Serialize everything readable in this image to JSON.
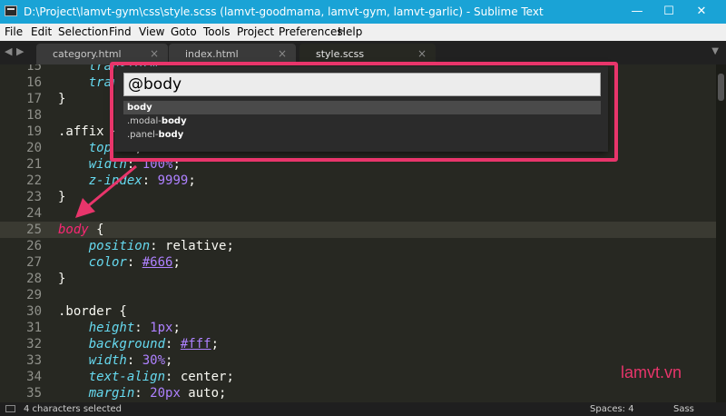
{
  "window": {
    "title": "D:\\Project\\lamvt-gym\\css\\style.scss (lamvt-goodmama, lamvt-gym, lamvt-garlic) - Sublime Text",
    "minimize": "—",
    "maximize": "☐",
    "close": "✕"
  },
  "menu": [
    "File",
    "Edit",
    "Selection",
    "Find",
    "View",
    "Goto",
    "Tools",
    "Project",
    "Preferences",
    "Help"
  ],
  "tabs": [
    {
      "label": "category.html",
      "close": "×"
    },
    {
      "label": "index.html",
      "close": "×"
    },
    {
      "label": "style.scss",
      "close": "×"
    }
  ],
  "tab_nav": {
    "left": "◀",
    "right": "▶",
    "dropdown": "▼"
  },
  "palette": {
    "value": "@body",
    "items": [
      {
        "pre": "",
        "match": "body",
        "post": ""
      },
      {
        "pre": ".modal-",
        "match": "body",
        "post": ""
      },
      {
        "pre": ".panel-",
        "match": "body",
        "post": ""
      }
    ]
  },
  "code": {
    "lines": [
      {
        "n": "15",
        "c": [
          {
            "t": "    ",
            "k": ""
          },
          {
            "t": "transform",
            "k": "prop"
          }
        ]
      },
      {
        "n": "16",
        "c": [
          {
            "t": "    ",
            "k": ""
          },
          {
            "t": "trans",
            "k": "prop"
          }
        ]
      },
      {
        "n": "17",
        "c": [
          {
            "t": "}",
            "k": ""
          }
        ]
      },
      {
        "n": "18",
        "c": []
      },
      {
        "n": "19",
        "c": [
          {
            "t": ".affix {",
            "k": ""
          }
        ]
      },
      {
        "n": "20",
        "c": [
          {
            "t": "    ",
            "k": ""
          },
          {
            "t": "top",
            "k": "prop"
          },
          {
            "t": ": ",
            "k": ""
          },
          {
            "t": "0",
            "k": "num"
          },
          {
            "t": ";",
            "k": ""
          }
        ]
      },
      {
        "n": "21",
        "c": [
          {
            "t": "    ",
            "k": ""
          },
          {
            "t": "width",
            "k": "prop"
          },
          {
            "t": ": ",
            "k": ""
          },
          {
            "t": "100%",
            "k": "num"
          },
          {
            "t": ";",
            "k": ""
          }
        ]
      },
      {
        "n": "22",
        "c": [
          {
            "t": "    ",
            "k": ""
          },
          {
            "t": "z-index",
            "k": "prop"
          },
          {
            "t": ": ",
            "k": ""
          },
          {
            "t": "9999",
            "k": "num"
          },
          {
            "t": ";",
            "k": ""
          }
        ]
      },
      {
        "n": "23",
        "c": [
          {
            "t": "}",
            "k": ""
          }
        ]
      },
      {
        "n": "24",
        "c": []
      },
      {
        "n": "25",
        "c": [
          {
            "t": "body",
            "k": "sel"
          },
          {
            "t": " {",
            "k": ""
          }
        ]
      },
      {
        "n": "26",
        "c": [
          {
            "t": "    ",
            "k": ""
          },
          {
            "t": "position",
            "k": "prop"
          },
          {
            "t": ": relative;",
            "k": ""
          }
        ]
      },
      {
        "n": "27",
        "c": [
          {
            "t": "    ",
            "k": ""
          },
          {
            "t": "color",
            "k": "prop"
          },
          {
            "t": ": ",
            "k": ""
          },
          {
            "t": "#666",
            "k": "hex"
          },
          {
            "t": ";",
            "k": ""
          }
        ]
      },
      {
        "n": "28",
        "c": [
          {
            "t": "}",
            "k": ""
          }
        ]
      },
      {
        "n": "29",
        "c": []
      },
      {
        "n": "30",
        "c": [
          {
            "t": ".border {",
            "k": ""
          }
        ]
      },
      {
        "n": "31",
        "c": [
          {
            "t": "    ",
            "k": ""
          },
          {
            "t": "height",
            "k": "prop"
          },
          {
            "t": ": ",
            "k": ""
          },
          {
            "t": "1px",
            "k": "num"
          },
          {
            "t": ";",
            "k": ""
          }
        ]
      },
      {
        "n": "32",
        "c": [
          {
            "t": "    ",
            "k": ""
          },
          {
            "t": "background",
            "k": "prop"
          },
          {
            "t": ": ",
            "k": ""
          },
          {
            "t": "#fff",
            "k": "hex"
          },
          {
            "t": ";",
            "k": ""
          }
        ]
      },
      {
        "n": "33",
        "c": [
          {
            "t": "    ",
            "k": ""
          },
          {
            "t": "width",
            "k": "prop"
          },
          {
            "t": ": ",
            "k": ""
          },
          {
            "t": "30%",
            "k": "num"
          },
          {
            "t": ";",
            "k": ""
          }
        ]
      },
      {
        "n": "34",
        "c": [
          {
            "t": "    ",
            "k": ""
          },
          {
            "t": "text-align",
            "k": "prop"
          },
          {
            "t": ": center;",
            "k": ""
          }
        ]
      },
      {
        "n": "35",
        "c": [
          {
            "t": "    ",
            "k": ""
          },
          {
            "t": "margin",
            "k": "prop"
          },
          {
            "t": ": ",
            "k": ""
          },
          {
            "t": "20px",
            "k": "num"
          },
          {
            "t": " auto;",
            "k": ""
          }
        ]
      }
    ]
  },
  "status": {
    "left": "4 characters selected",
    "spaces": "Spaces: 4",
    "syntax": "Sass"
  },
  "watermark": "lamvt.vn",
  "colors": {
    "accent": "#e8356b",
    "titlebar": "#1aa3d6",
    "background": "#272822"
  }
}
